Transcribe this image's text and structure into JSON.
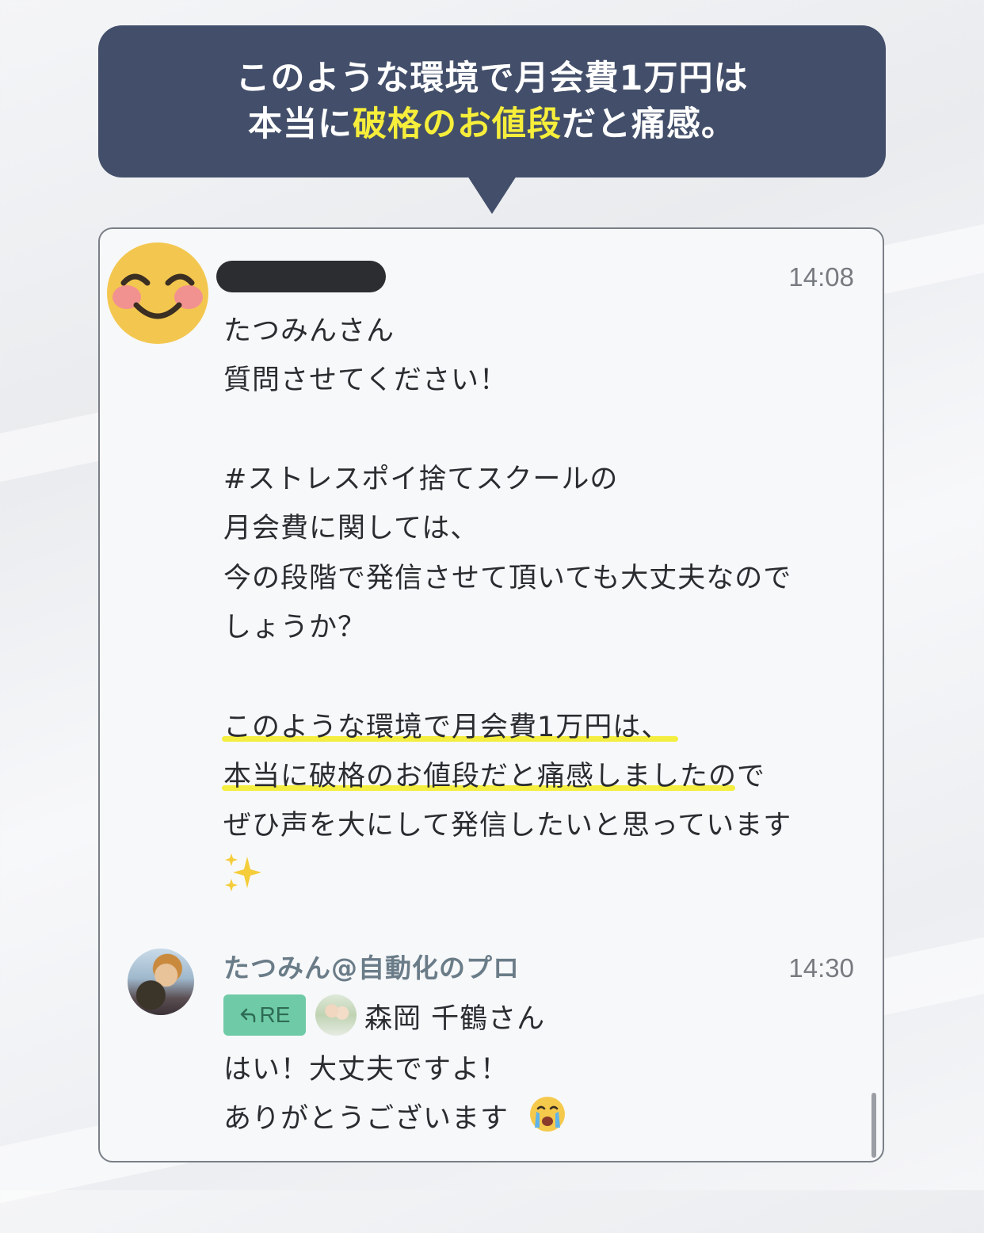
{
  "callout": {
    "line1": "このような環境で月会費1万円は",
    "line2_prefix": "本当に",
    "line2_highlight": "破格のお値段",
    "line2_suffix": "だと痛感。"
  },
  "message1": {
    "avatar_icon": "smiling-face-emoji",
    "time": "14:08",
    "lines": [
      "たつみんさん",
      "質問させてください！",
      "#ストレスポイ捨てスクールの",
      "月会費に関しては、",
      "今の段階で発信させて頂いても大丈夫なので",
      "しょうか？",
      "このような環境で月会費1万円は、",
      "本当に破格のお値段だと痛感しましたので",
      "ぜひ声を大にして発信したいと思っています"
    ],
    "trailing_icon": "sparkles-emoji"
  },
  "message2": {
    "sender": "たつみん@自動化のプロ",
    "time": "14:30",
    "reply_badge": "RE",
    "reply_to": "森岡 千鶴さん",
    "lines": [
      "はい！大丈夫ですよ！",
      "ありがとうございます"
    ],
    "trailing_icon": "crying-face-emoji"
  },
  "colors": {
    "callout_bg": "#434f6a",
    "highlight": "#f6ee3a",
    "underline": "#f3ee3f",
    "re_badge": "#6fcba7"
  }
}
